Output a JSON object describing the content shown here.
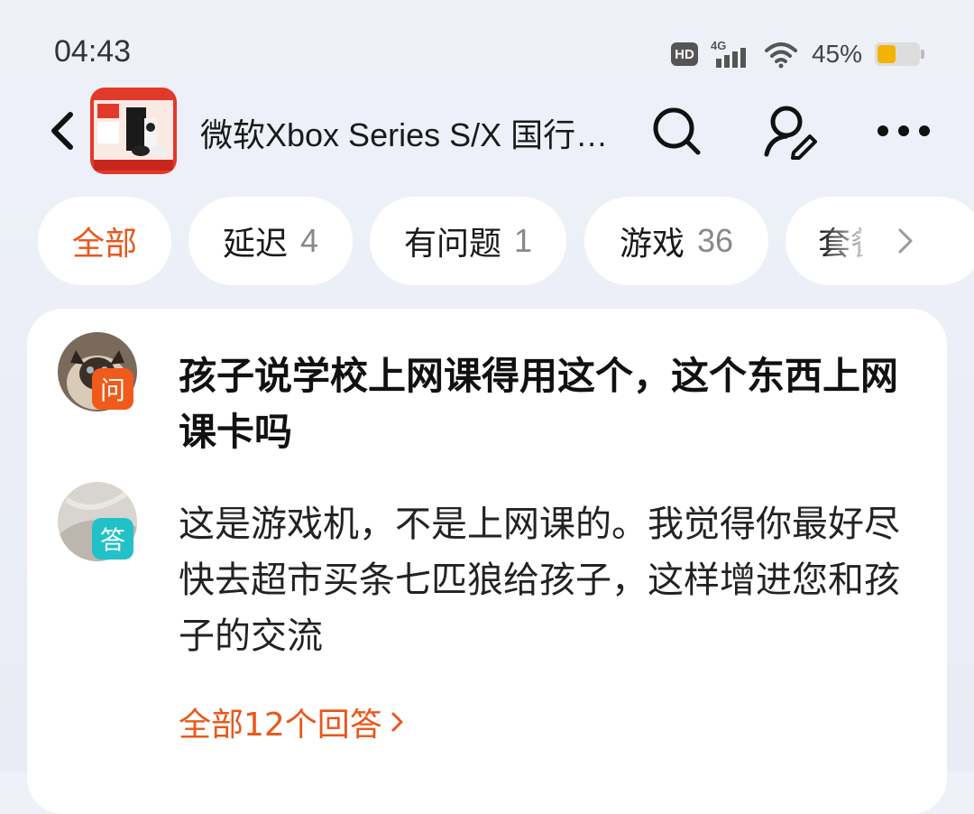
{
  "status_bar": {
    "time": "04:43",
    "hd": "HD",
    "network": "4G",
    "battery_pct": "45%",
    "battery_level": 0.45
  },
  "header": {
    "title": "微软Xbox Series S/X 国行…"
  },
  "tabs": [
    {
      "label": "全部",
      "count": ""
    },
    {
      "label": "延迟",
      "count": "4"
    },
    {
      "label": "有问题",
      "count": "1"
    },
    {
      "label": "游戏",
      "count": "36"
    },
    {
      "label": "套餐",
      "count": ""
    }
  ],
  "card": {
    "question_badge": "问",
    "question": "孩子说学校上网课得用这个，这个东西上网课卡吗",
    "answer_badge": "答",
    "answer": "这是游戏机，不是上网课的。我觉得你最好尽快去超市买条七匹狼给孩子，这样增进您和孩子的交流",
    "more_answers": "全部12个回答"
  },
  "colors": {
    "accent": "#e8581c",
    "question_badge": "#f05a1a",
    "answer_badge": "#22c1c8"
  }
}
